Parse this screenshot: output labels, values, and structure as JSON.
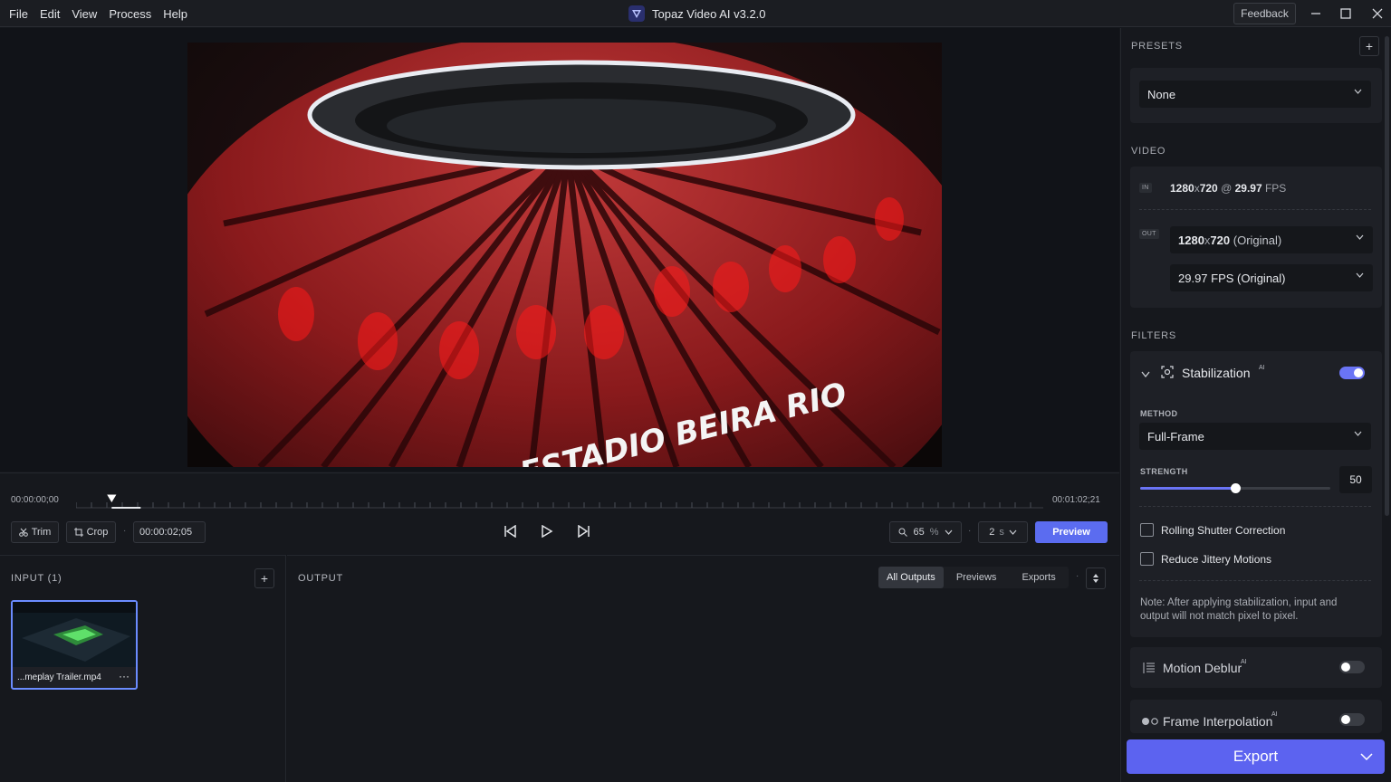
{
  "menu": [
    "File",
    "Edit",
    "View",
    "Process",
    "Help"
  ],
  "app": {
    "title": "Topaz Video AI  v3.2.0",
    "feedback": "Feedback"
  },
  "video_overlay_text": "ESTADIO BEIRA RIO",
  "timeline": {
    "start": "00:00:00;00",
    "end": "00:01:02;21",
    "trim": "Trim",
    "crop": "Crop",
    "current_time": "00:00:02;05",
    "zoom": "65",
    "zoom_unit": "%",
    "preview_duration": "2",
    "preview_duration_unit": "s",
    "preview": "Preview",
    "playhead_fraction": 0.034
  },
  "input": {
    "title": "INPUT (1)",
    "file_name": "...meplay Trailer.mp4"
  },
  "output": {
    "title": "OUTPUT",
    "tabs": [
      "All Outputs",
      "Previews",
      "Exports"
    ],
    "active_tab": 0
  },
  "presets": {
    "title": "PRESETS",
    "value": "None"
  },
  "video": {
    "title": "VIDEO",
    "in_tag": "IN",
    "in_res": "1280",
    "in_x": "x",
    "in_res2": "720",
    "in_at": " @ ",
    "in_fps": "29.97",
    "in_fps_unit": "FPS",
    "out_tag": "OUT",
    "out_res": "1280",
    "out_x": "x",
    "out_res2": "720",
    "out_res_note": "(Original)",
    "out_fps": "29.97 FPS (Original)"
  },
  "filters": {
    "title": "FILTERS",
    "stabilization": {
      "label": "Stabilization",
      "ai": "AI",
      "enabled": true,
      "method_label": "METHOD",
      "method": "Full-Frame",
      "strength_label": "STRENGTH",
      "strength": "50",
      "strength_fraction": 0.5,
      "rolling_shutter": "Rolling Shutter Correction",
      "reduce_jittery": "Reduce Jittery Motions",
      "note": "Note: After applying stabilization, input and output will not match pixel to pixel."
    },
    "motion_deblur": {
      "label": "Motion Deblur",
      "ai": "AI",
      "enabled": false
    },
    "frame_interpolation": {
      "label": "Frame Interpolation",
      "ai": "AI",
      "enabled": false
    }
  },
  "export": "Export",
  "colors": {
    "accent": "#5c63f0",
    "toggle_on": "#6a74f5",
    "toggle_off": "#3a3d44"
  }
}
